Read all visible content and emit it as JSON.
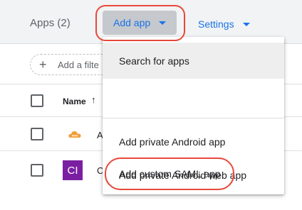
{
  "toolbar": {
    "apps_count": "Apps (2)",
    "add_app_label": "Add app",
    "settings_label": "Settings"
  },
  "filter": {
    "label": "Add a filte"
  },
  "table": {
    "name_header": "Name",
    "sort_icon": "↑",
    "rows": [
      {
        "icon": "aws-icon",
        "label": "A"
      },
      {
        "icon_text": "CI",
        "label": "C"
      }
    ]
  },
  "menu": {
    "items": [
      "Search for apps",
      "Add private Android app",
      "Add private Android web app",
      "Add custom SAML app"
    ]
  },
  "colors": {
    "accent": "#1a73e8",
    "highlight_ring": "#e8483a",
    "ci_icon": "#7b1fa2",
    "aws_icon": "#f29d38"
  }
}
